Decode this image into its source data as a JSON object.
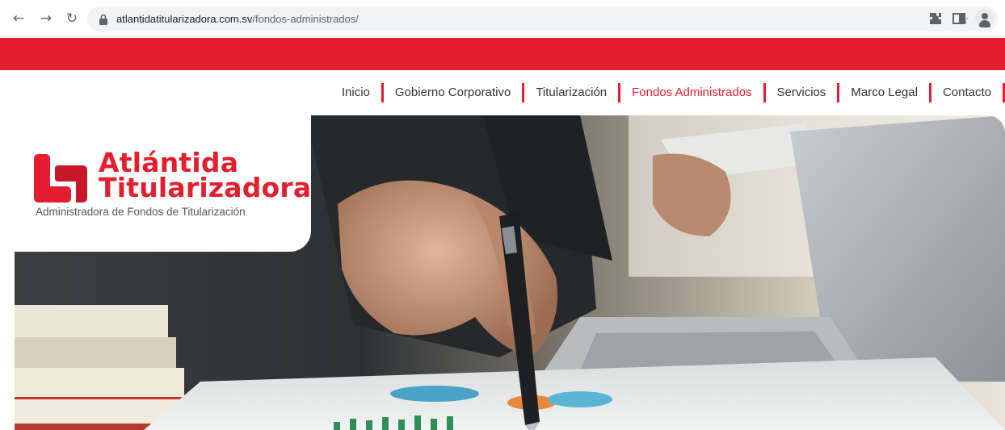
{
  "browser": {
    "url_host": "atlantidatitularizadora.com.sv",
    "url_path": "/fondos-administrados/",
    "back_icon": "arrow-left-icon",
    "forward_icon": "arrow-right-icon",
    "reload_icon": "reload-icon"
  },
  "colors": {
    "brand_red": "#e31e2e",
    "nav_text": "#333333",
    "tagline": "#555555"
  },
  "nav": {
    "items": [
      {
        "label": "Inicio",
        "active": false
      },
      {
        "label": "Gobierno Corporativo",
        "active": false
      },
      {
        "label": "Titularización",
        "active": false
      },
      {
        "label": "Fondos Administrados",
        "active": true
      },
      {
        "label": "Servicios",
        "active": false
      },
      {
        "label": "Marco Legal",
        "active": false
      },
      {
        "label": "Contacto",
        "active": false
      }
    ]
  },
  "logo": {
    "line1": "Atlántida",
    "line2": "Titularizadora",
    "tagline": "Administradora de Fondos de Titularización"
  }
}
